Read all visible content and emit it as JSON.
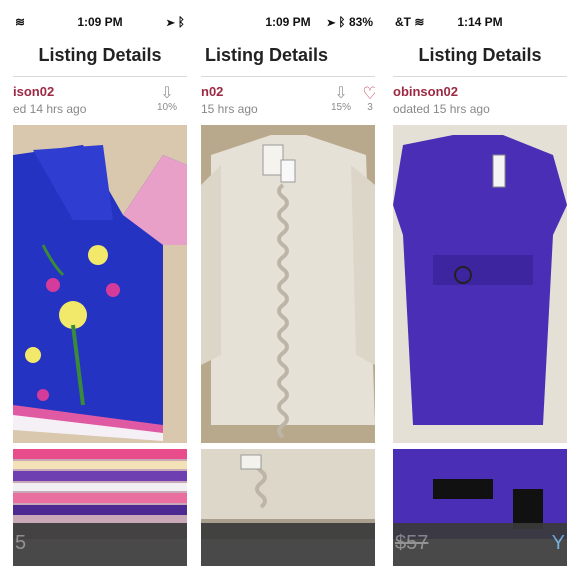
{
  "panels": [
    {
      "status": {
        "left": "",
        "time": "1:09 PM",
        "right": ""
      },
      "title": "Listing Details",
      "seller": {
        "username": "ison02",
        "updated": "ed 14 hrs ago"
      },
      "metrics": {
        "share_pct": "10%",
        "likes": ""
      },
      "price": {
        "value": "5",
        "strikethrough": false,
        "extra": ""
      }
    },
    {
      "status": {
        "left": "",
        "time": "1:09 PM",
        "right": "83%"
      },
      "title": "Listing Details",
      "seller": {
        "username": "n02",
        "updated": "15 hrs ago"
      },
      "metrics": {
        "share_pct": "15%",
        "likes": "3"
      },
      "price": {
        "value": "",
        "strikethrough": false,
        "extra": ""
      }
    },
    {
      "status": {
        "left": "&T",
        "time": "1:14 PM",
        "right": ""
      },
      "title": "Listing Details",
      "seller": {
        "username": "obinson02",
        "updated": "odated 15 hrs ago"
      },
      "metrics": {
        "share_pct": "",
        "likes": ""
      },
      "price": {
        "value": "$57",
        "strikethrough": true,
        "extra": ""
      }
    }
  ],
  "colors": {
    "username": "#9c2a44",
    "heart": "#c04050",
    "price_bar": "#3a3a3a"
  },
  "icons": [
    "wifi-icon",
    "location-arrow-icon",
    "bluetooth-icon",
    "share-arrow-icon",
    "heart-icon"
  ]
}
